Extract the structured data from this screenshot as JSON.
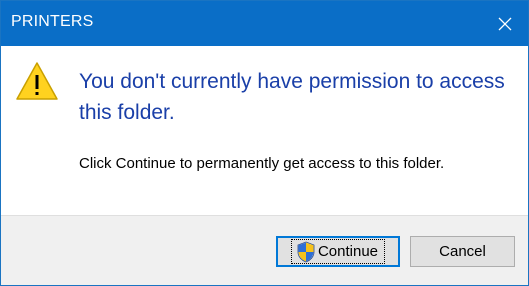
{
  "window": {
    "title": "PRINTERS",
    "close_glyph": "✕"
  },
  "message": {
    "instruction": "You don't currently have permission to access this folder.",
    "detail": "Click Continue to permanently get access to this folder."
  },
  "buttons": {
    "continue_label": "Continue",
    "cancel_label": "Cancel"
  },
  "icons": {
    "warning": "warning-icon",
    "shield": "uac-shield-icon",
    "close": "close-icon"
  },
  "colors": {
    "titlebar": "#0a6ec7",
    "instruction_text": "#1a3fa8",
    "warning_fill": "#ffd21f",
    "focus_border": "#0078d7"
  }
}
